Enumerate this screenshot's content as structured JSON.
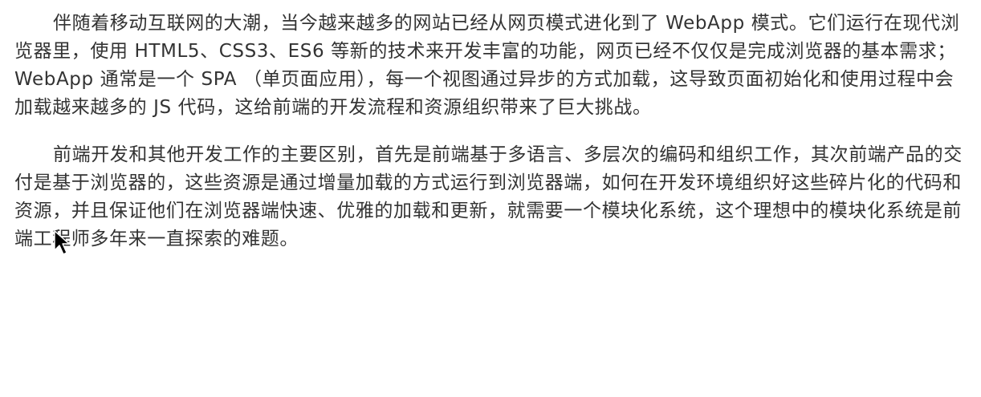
{
  "article": {
    "paragraphs": [
      "伴随着移动互联网的大潮，当今越来越多的网站已经从网页模式进化到了 WebApp 模式。它们运行在现代浏览器里，使用 HTML5、CSS3、ES6 等新的技术来开发丰富的功能，网页已经不仅仅是完成浏览器的基本需求；WebApp 通常是一个 SPA （单页面应用），每一个视图通过异步的方式加载，这导致页面初始化和使用过程中会加载越来越多的 JS 代码，这给前端的开发流程和资源组织带来了巨大挑战。",
      "前端开发和其他开发工作的主要区别，首先是前端基于多语言、多层次的编码和组织工作，其次前端产品的交付是基于浏览器的，这些资源是通过增量加载的方式运行到浏览器端，如何在开发环境组织好这些碎片化的代码和资源，并且保证他们在浏览器端快速、优雅的加载和更新，就需要一个模块化系统，这个理想中的模块化系统是前端工程师多年来一直探索的难题。"
    ]
  },
  "colors": {
    "text": "#333333",
    "background": "#ffffff",
    "cursor": "#000000"
  },
  "icons": {
    "cursor": "mouse-pointer-icon"
  }
}
